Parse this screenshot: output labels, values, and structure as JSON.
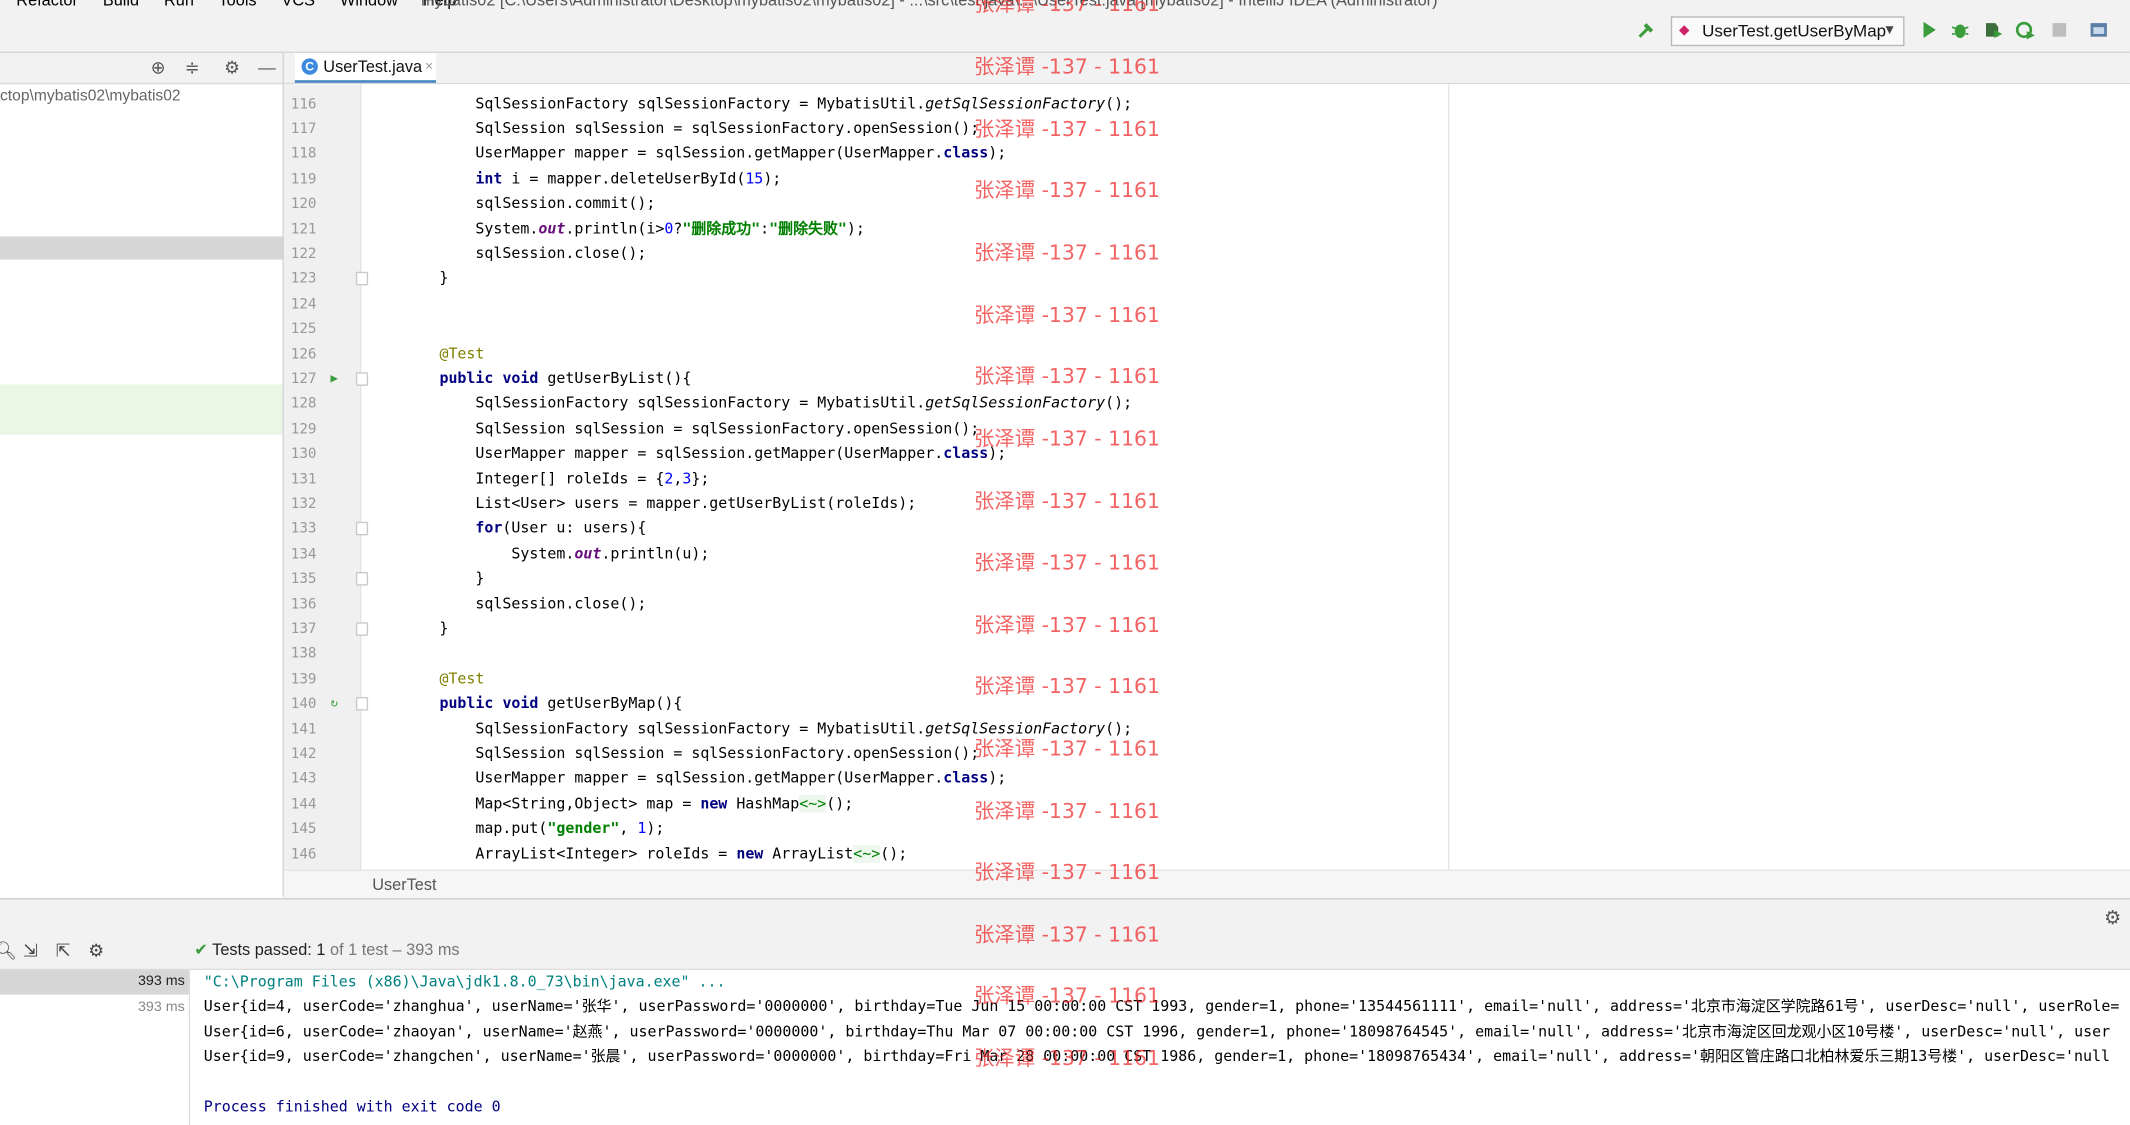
{
  "menu": {
    "items": [
      "Refactor",
      "Build",
      "Run",
      "Tools",
      "VCS",
      "Window",
      "Help"
    ],
    "title_path": "mybatis02 [C:\\Users\\Administrator\\Desktop\\mybatis02\\mybatis02] - ...\\src\\test\\java\\...\\UserTest.java [mybatis02] - IntelliJ IDEA (Administrator)"
  },
  "toolbar": {
    "run_config": "UserTest.getUserByMap",
    "icons": [
      "build-hammer-icon",
      "run-icon",
      "debug-icon",
      "coverage-icon",
      "profile-icon",
      "stop-icon",
      "project-structure-icon"
    ]
  },
  "project_panel": {
    "path": "ctop\\mybatis02\\mybatis02"
  },
  "editor": {
    "tab": {
      "label": "UserTest.java",
      "close": "×",
      "icon_letter": "C"
    },
    "lines": [
      {
        "n": "116",
        "code": "        SqlSessionFactory sqlSessionFactory = MybatisUtil.getSqlSessionFactory();"
      },
      {
        "n": "117",
        "code": "        SqlSession sqlSession = sqlSessionFactory.openSession();"
      },
      {
        "n": "118",
        "code": "        UserMapper mapper = sqlSession.getMapper(UserMapper.class);"
      },
      {
        "n": "119",
        "code": "        int i = mapper.deleteUserById(15);"
      },
      {
        "n": "120",
        "code": "        sqlSession.commit();"
      },
      {
        "n": "121",
        "code": "        System.out.println(i>0?\"删除成功\":\"删除失败\");"
      },
      {
        "n": "122",
        "code": "        sqlSession.close();"
      },
      {
        "n": "123",
        "code": "    }"
      },
      {
        "n": "124",
        "code": ""
      },
      {
        "n": "125",
        "code": ""
      },
      {
        "n": "126",
        "code": "    @Test"
      },
      {
        "n": "127",
        "code": "    public void getUserByList(){"
      },
      {
        "n": "128",
        "code": "        SqlSessionFactory sqlSessionFactory = MybatisUtil.getSqlSessionFactory();"
      },
      {
        "n": "129",
        "code": "        SqlSession sqlSession = sqlSessionFactory.openSession();"
      },
      {
        "n": "130",
        "code": "        UserMapper mapper = sqlSession.getMapper(UserMapper.class);"
      },
      {
        "n": "131",
        "code": "        Integer[] roleIds = {2,3};"
      },
      {
        "n": "132",
        "code": "        List<User> users = mapper.getUserByList(roleIds);"
      },
      {
        "n": "133",
        "code": "        for(User u: users){"
      },
      {
        "n": "134",
        "code": "            System.out.println(u);"
      },
      {
        "n": "135",
        "code": "        }"
      },
      {
        "n": "136",
        "code": "        sqlSession.close();"
      },
      {
        "n": "137",
        "code": "    }"
      },
      {
        "n": "138",
        "code": ""
      },
      {
        "n": "139",
        "code": "    @Test"
      },
      {
        "n": "140",
        "code": "    public void getUserByMap(){"
      },
      {
        "n": "141",
        "code": "        SqlSessionFactory sqlSessionFactory = MybatisUtil.getSqlSessionFactory();"
      },
      {
        "n": "142",
        "code": "        SqlSession sqlSession = sqlSessionFactory.openSession();"
      },
      {
        "n": "143",
        "code": "        UserMapper mapper = sqlSession.getMapper(UserMapper.class);"
      },
      {
        "n": "144",
        "code": "        Map<String,Object> map = new HashMap<~>();"
      },
      {
        "n": "145",
        "code": "        map.put(\"gender\", 1);"
      },
      {
        "n": "146",
        "code": "        ArrayList<Integer> roleIds = new ArrayList<~>();"
      }
    ],
    "breadcrumb": "UserTest"
  },
  "run_panel": {
    "status_passed": "Tests passed:",
    "status_count": "1",
    "status_rest": "of 1 test – 393 ms",
    "tree_time_1": "393 ms",
    "tree_time_2": "393 ms",
    "console": [
      "\"C:\\Program Files (x86)\\Java\\jdk1.8.0_73\\bin\\java.exe\" ...",
      "User{id=4, userCode='zhanghua', userName='张华', userPassword='0000000', birthday=Tue Jun 15 00:00:00 CST 1993, gender=1, phone='13544561111', email='null', address='北京市海淀区学院路61号', userDesc='null', userRole=",
      "User{id=6, userCode='zhaoyan', userName='赵燕', userPassword='0000000', birthday=Thu Mar 07 00:00:00 CST 1996, gender=1, phone='18098764545', email='null', address='北京市海淀区回龙观小区10号楼', userDesc='null', user",
      "User{id=9, userCode='zhangchen', userName='张晨', userPassword='0000000', birthday=Fri Mar 28 00:00:00 CST 1986, gender=1, phone='18098765434', email='null', address='朝阳区管庄路口北柏林爱乐三期13号楼', userDesc='null",
      "",
      "Process finished with exit code 0"
    ]
  },
  "watermark": "张泽谭 -137 - 1161"
}
